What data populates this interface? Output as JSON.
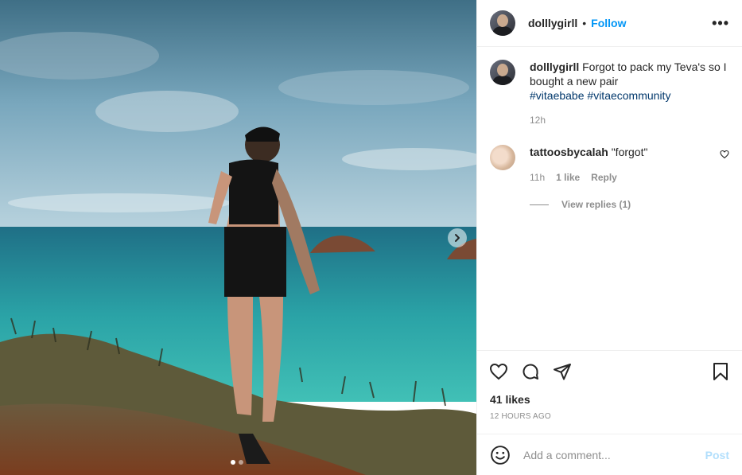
{
  "post": {
    "username": "dolllygirll",
    "bullet": "•",
    "follow_label": "Follow",
    "more_label": "•••"
  },
  "caption": {
    "username": "dolllygirll",
    "text": "Forgot to pack my Teva's so I bought a new pair",
    "hashtags": [
      "#vitaebabe",
      "#vitaecommunity"
    ],
    "age": "12h"
  },
  "comments": [
    {
      "username": "tattoosbycalah",
      "text": "\"forgot\"",
      "age": "11h",
      "likes": "1 like",
      "reply_label": "Reply",
      "view_replies": "View replies (1)"
    }
  ],
  "engagement": {
    "likes": "41 likes",
    "timestamp": "12 HOURS AGO"
  },
  "composer": {
    "placeholder": "Add a comment...",
    "post_label": "Post"
  },
  "carousel": {
    "slides": 2,
    "current": 1
  },
  "icons": {
    "like": "heart-icon",
    "comment": "comment-icon",
    "share": "share-icon",
    "save": "bookmark-icon",
    "emoji": "emoji-icon",
    "next": "chevron-right-icon"
  },
  "colors": {
    "accent": "#0095f6",
    "hashtag": "#00376b",
    "muted": "#8e8e8e",
    "post_disabled": "#b2dffc"
  }
}
